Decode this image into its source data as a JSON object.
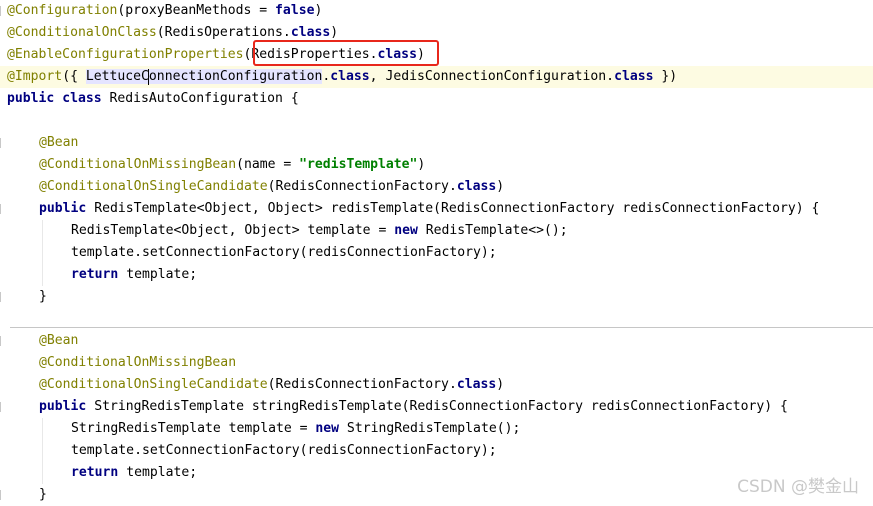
{
  "code": {
    "line1": {
      "annotation": "@Configuration",
      "open": "(",
      "arg": "proxyBeanMethods = ",
      "value": "false",
      "close": ")"
    },
    "line2": {
      "annotation": "@ConditionalOnClass",
      "open": "(",
      "cls": "RedisOperations.",
      "kw": "class",
      "close": ")"
    },
    "line3": {
      "annotation": "@EnableConfigurationProperties",
      "open": "(",
      "cls": "RedisProperties.",
      "kw": "class",
      "close": ")"
    },
    "line4": {
      "annotation": "@Import",
      "open": "({ ",
      "cls1a": "LettuceC",
      "cls1b": "onnectionConfiguration",
      "dot1": ".",
      "kw1": "class",
      "sep": ", JedisConnectionConfiguration.",
      "kw2": "class",
      "close": " })"
    },
    "line5": {
      "kw1": "public",
      "kw2": "class",
      "name": " RedisAutoConfiguration {"
    },
    "line7": {
      "annotation": "@Bean"
    },
    "line8": {
      "annotation": "@ConditionalOnMissingBean",
      "open": "(name = ",
      "string": "\"redisTemplate\"",
      "close": ")"
    },
    "line9": {
      "annotation": "@ConditionalOnSingleCandidate",
      "open": "(",
      "cls": "RedisConnectionFactory.",
      "kw": "class",
      "close": ")"
    },
    "line10": {
      "kw": "public",
      "sig": " RedisTemplate<Object, Object> redisTemplate(RedisConnectionFactory redisConnectionFactory) {"
    },
    "line11": {
      "decl": "RedisTemplate<Object, Object> template = ",
      "kw": "new",
      "rest": " RedisTemplate<>();"
    },
    "line12": {
      "text": "template.setConnectionFactory(redisConnectionFactory);"
    },
    "line13": {
      "kw": "return",
      "rest": " template;"
    },
    "line14": {
      "text": "}"
    },
    "line16": {
      "annotation": "@Bean"
    },
    "line17": {
      "annotation": "@ConditionalOnMissingBean"
    },
    "line18": {
      "annotation": "@ConditionalOnSingleCandidate",
      "open": "(",
      "cls": "RedisConnectionFactory.",
      "kw": "class",
      "close": ")"
    },
    "line19": {
      "kw": "public",
      "sig": " StringRedisTemplate stringRedisTemplate(RedisConnectionFactory redisConnectionFactory) {"
    },
    "line20": {
      "decl": "StringRedisTemplate template = ",
      "kw": "new",
      "rest": " StringRedisTemplate();"
    },
    "line21": {
      "text": "template.setConnectionFactory(redisConnectionFactory);"
    },
    "line22": {
      "kw": "return",
      "rest": " template;"
    },
    "line23": {
      "text": "}"
    }
  },
  "watermark": "CSDN @樊金山",
  "colors": {
    "annotation": "#808000",
    "keyword": "#000080",
    "string": "#008000",
    "highlight_box": "#e8271b",
    "current_line": "#fdfbe2"
  }
}
